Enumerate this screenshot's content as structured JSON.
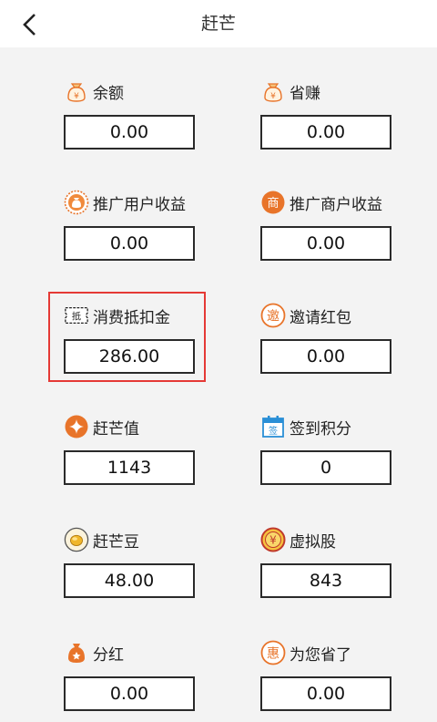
{
  "header": {
    "title": "赶芒"
  },
  "items": [
    {
      "label": "余额",
      "value": "0.00",
      "icon": "money-bag-icon"
    },
    {
      "label": "省赚",
      "value": "0.00",
      "icon": "money-bag-icon"
    },
    {
      "label": "推广用户收益",
      "value": "0.00",
      "icon": "coin-bag-circle-icon"
    },
    {
      "label": "推广商户收益",
      "value": "0.00",
      "icon": "shop-badge-icon",
      "badge": "商"
    },
    {
      "label": "消费抵扣金",
      "value": "286.00",
      "icon": "ticket-icon",
      "badge": "抵"
    },
    {
      "label": "邀请红包",
      "value": "0.00",
      "icon": "invite-badge-icon",
      "badge": "邀"
    },
    {
      "label": "赶芒值",
      "value": "1143",
      "icon": "diamond-badge-icon"
    },
    {
      "label": "签到积分",
      "value": "0",
      "icon": "calendar-sign-icon",
      "badge": "签"
    },
    {
      "label": "赶芒豆",
      "value": "48.00",
      "icon": "gold-bean-icon"
    },
    {
      "label": "虚拟股",
      "value": "843",
      "icon": "yen-coin-icon"
    },
    {
      "label": "分红",
      "value": "0.00",
      "icon": "dividend-bag-icon"
    },
    {
      "label": "为您省了",
      "value": "0.00",
      "icon": "save-badge-icon",
      "badge": "惠"
    }
  ],
  "colors": {
    "accent": "#e8742a",
    "highlight": "#e53935",
    "blue": "#2a8fd6"
  }
}
